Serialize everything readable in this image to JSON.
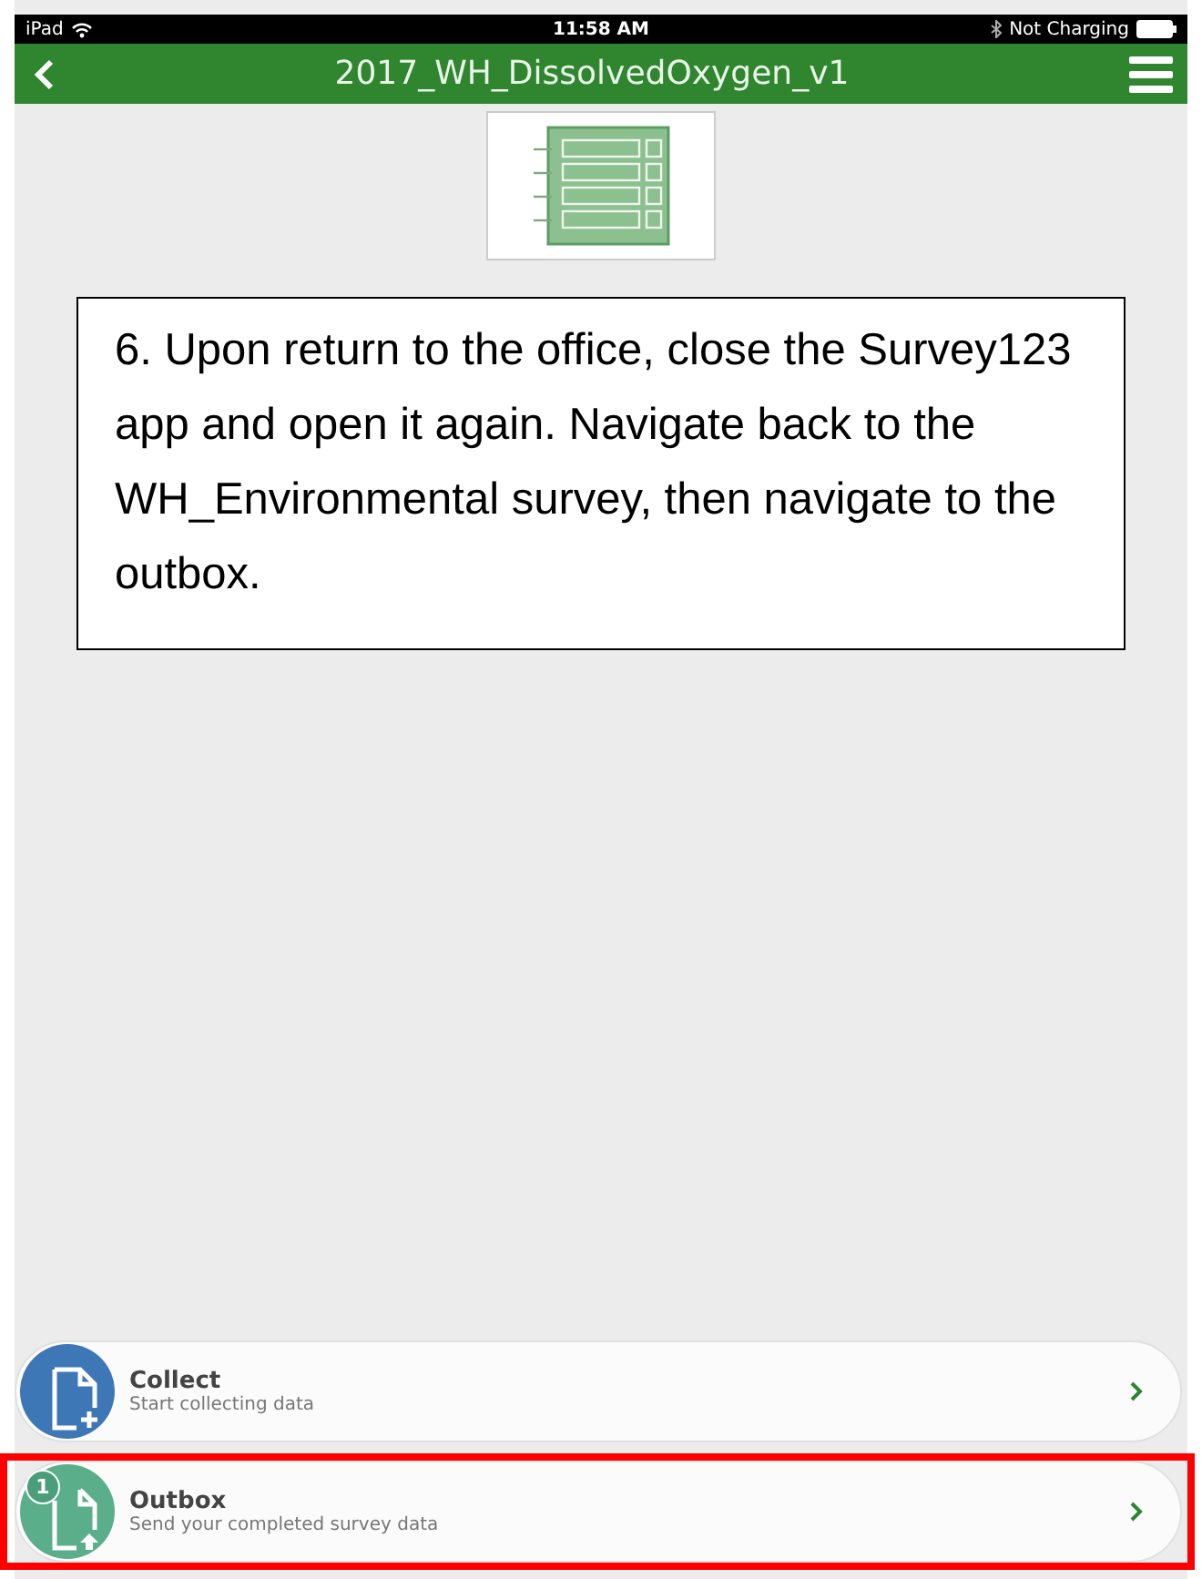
{
  "status_bar": {
    "device": "iPad",
    "time": "11:58 AM",
    "battery_text": "Not Charging"
  },
  "header": {
    "title": "2017_WH_DissolvedOxygen_v1"
  },
  "callout": {
    "text": "6. Upon return to the office, close the Survey123 app and open it again. Navigate back to the WH_Environmental survey, then navigate to the outbox."
  },
  "actions": [
    {
      "kind": "collect",
      "title": "Collect",
      "subtitle": "Start collecting data",
      "color": "#3d77b6",
      "highlighted": false
    },
    {
      "kind": "outbox",
      "title": "Outbox",
      "subtitle": "Send your completed survey data",
      "color": "#5aae8a",
      "badge": "1",
      "highlighted": true
    }
  ]
}
